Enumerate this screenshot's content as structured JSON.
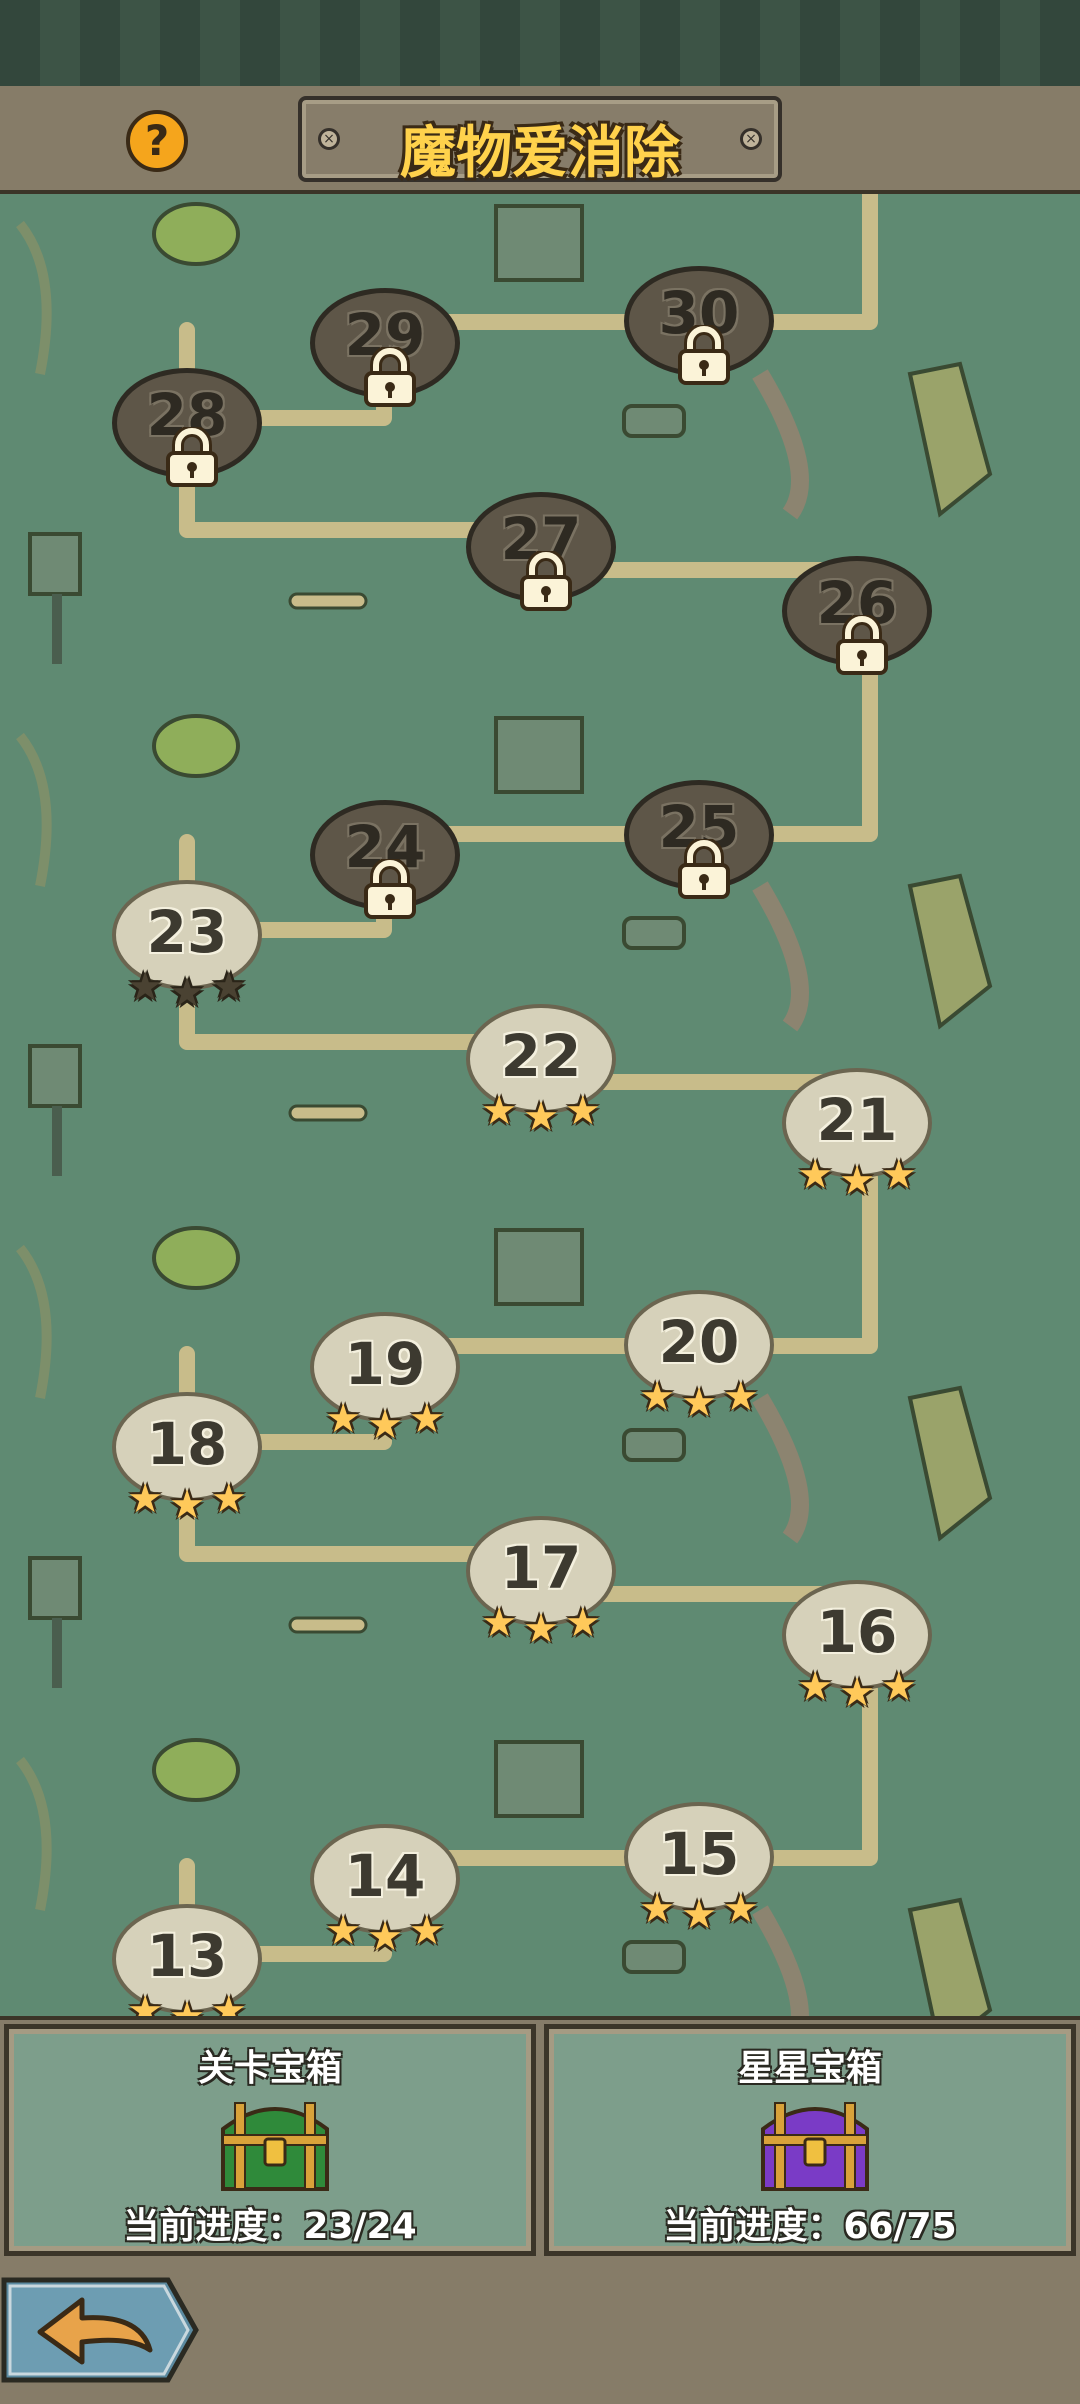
{
  "header": {
    "title": "魔物爱消除",
    "help_icon": "question-icon"
  },
  "levels": [
    {
      "num": "28",
      "locked": true
    },
    {
      "num": "29",
      "locked": true
    },
    {
      "num": "30",
      "locked": true
    },
    {
      "num": "27",
      "locked": true
    },
    {
      "num": "26",
      "locked": true
    },
    {
      "num": "24",
      "locked": true
    },
    {
      "num": "25",
      "locked": true
    },
    {
      "num": "23",
      "locked": false,
      "stars": 0
    },
    {
      "num": "22",
      "locked": false,
      "stars": 3
    },
    {
      "num": "21",
      "locked": false,
      "stars": 3
    },
    {
      "num": "19",
      "locked": false,
      "stars": 3
    },
    {
      "num": "20",
      "locked": false,
      "stars": 3
    },
    {
      "num": "18",
      "locked": false,
      "stars": 3
    },
    {
      "num": "17",
      "locked": false,
      "stars": 3
    },
    {
      "num": "16",
      "locked": false,
      "stars": 3
    },
    {
      "num": "14",
      "locked": false,
      "stars": 3
    },
    {
      "num": "15",
      "locked": false,
      "stars": 3
    },
    {
      "num": "13",
      "locked": false,
      "stars": 3
    }
  ],
  "chests": {
    "level": {
      "title": "关卡宝箱",
      "progress": "当前进度：23/24",
      "color": "#2f8a3a"
    },
    "star": {
      "title": "星星宝箱",
      "progress": "当前进度：66/75",
      "color": "#7a3bc6"
    }
  },
  "back_icon": "back-arrow-icon"
}
